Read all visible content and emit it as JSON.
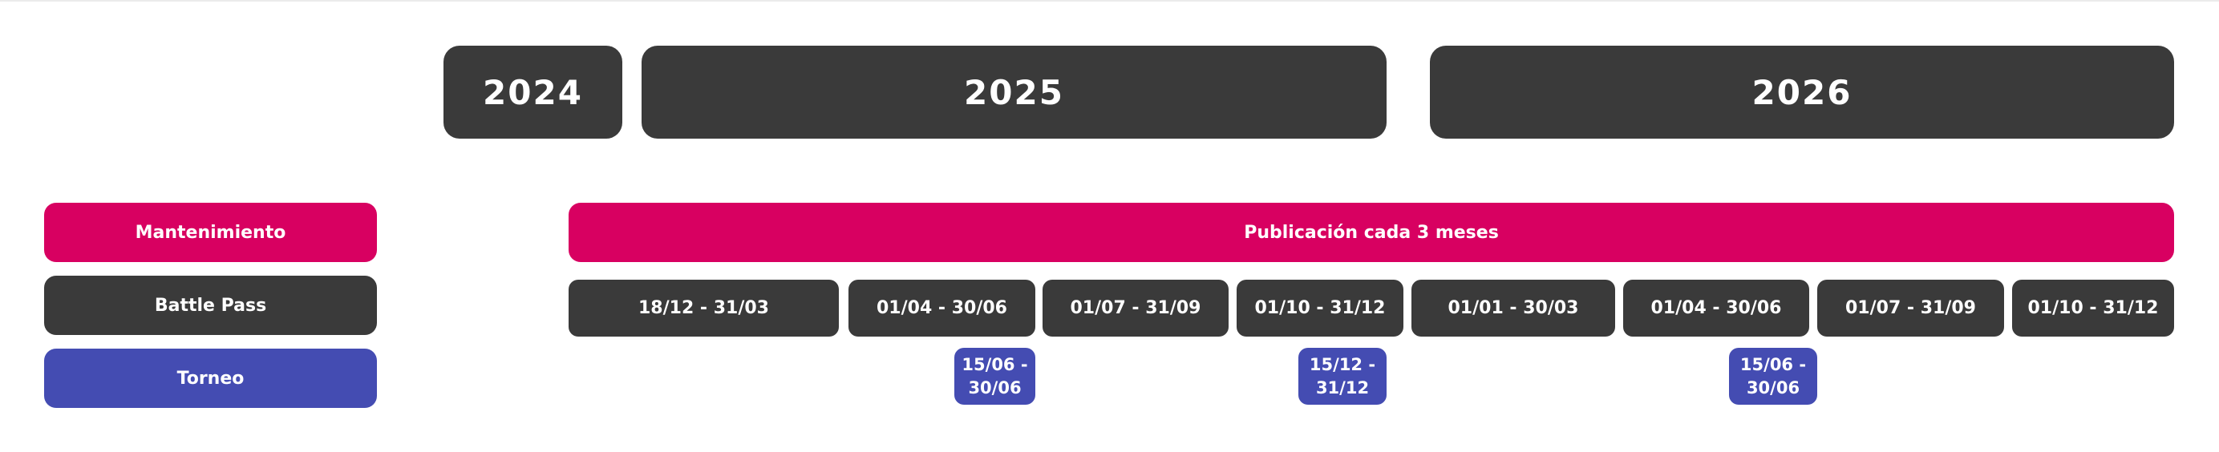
{
  "years": [
    "2024",
    "2025",
    "2026"
  ],
  "rows": {
    "mantenimiento": "Mantenimiento",
    "battle_pass": "Battle Pass",
    "torneo": "Torneo"
  },
  "publicacion": "Publicación cada 3 meses",
  "battle_pass_periods": [
    "18/12 - 31/03",
    "01/04 - 30/06",
    "01/07 - 31/09",
    "01/10 - 31/12",
    "01/01 - 30/03",
    "01/04 - 30/06",
    "01/07 - 31/09",
    "01/10 - 31/12"
  ],
  "torneo_periods": [
    [
      "15/06 -",
      "30/06"
    ],
    [
      "15/12 -",
      "31/12"
    ],
    [
      "15/06 -",
      "30/06"
    ]
  ],
  "colors": {
    "pink": "#d80061",
    "dark": "#3a3a3a",
    "blue": "#444cb2"
  }
}
